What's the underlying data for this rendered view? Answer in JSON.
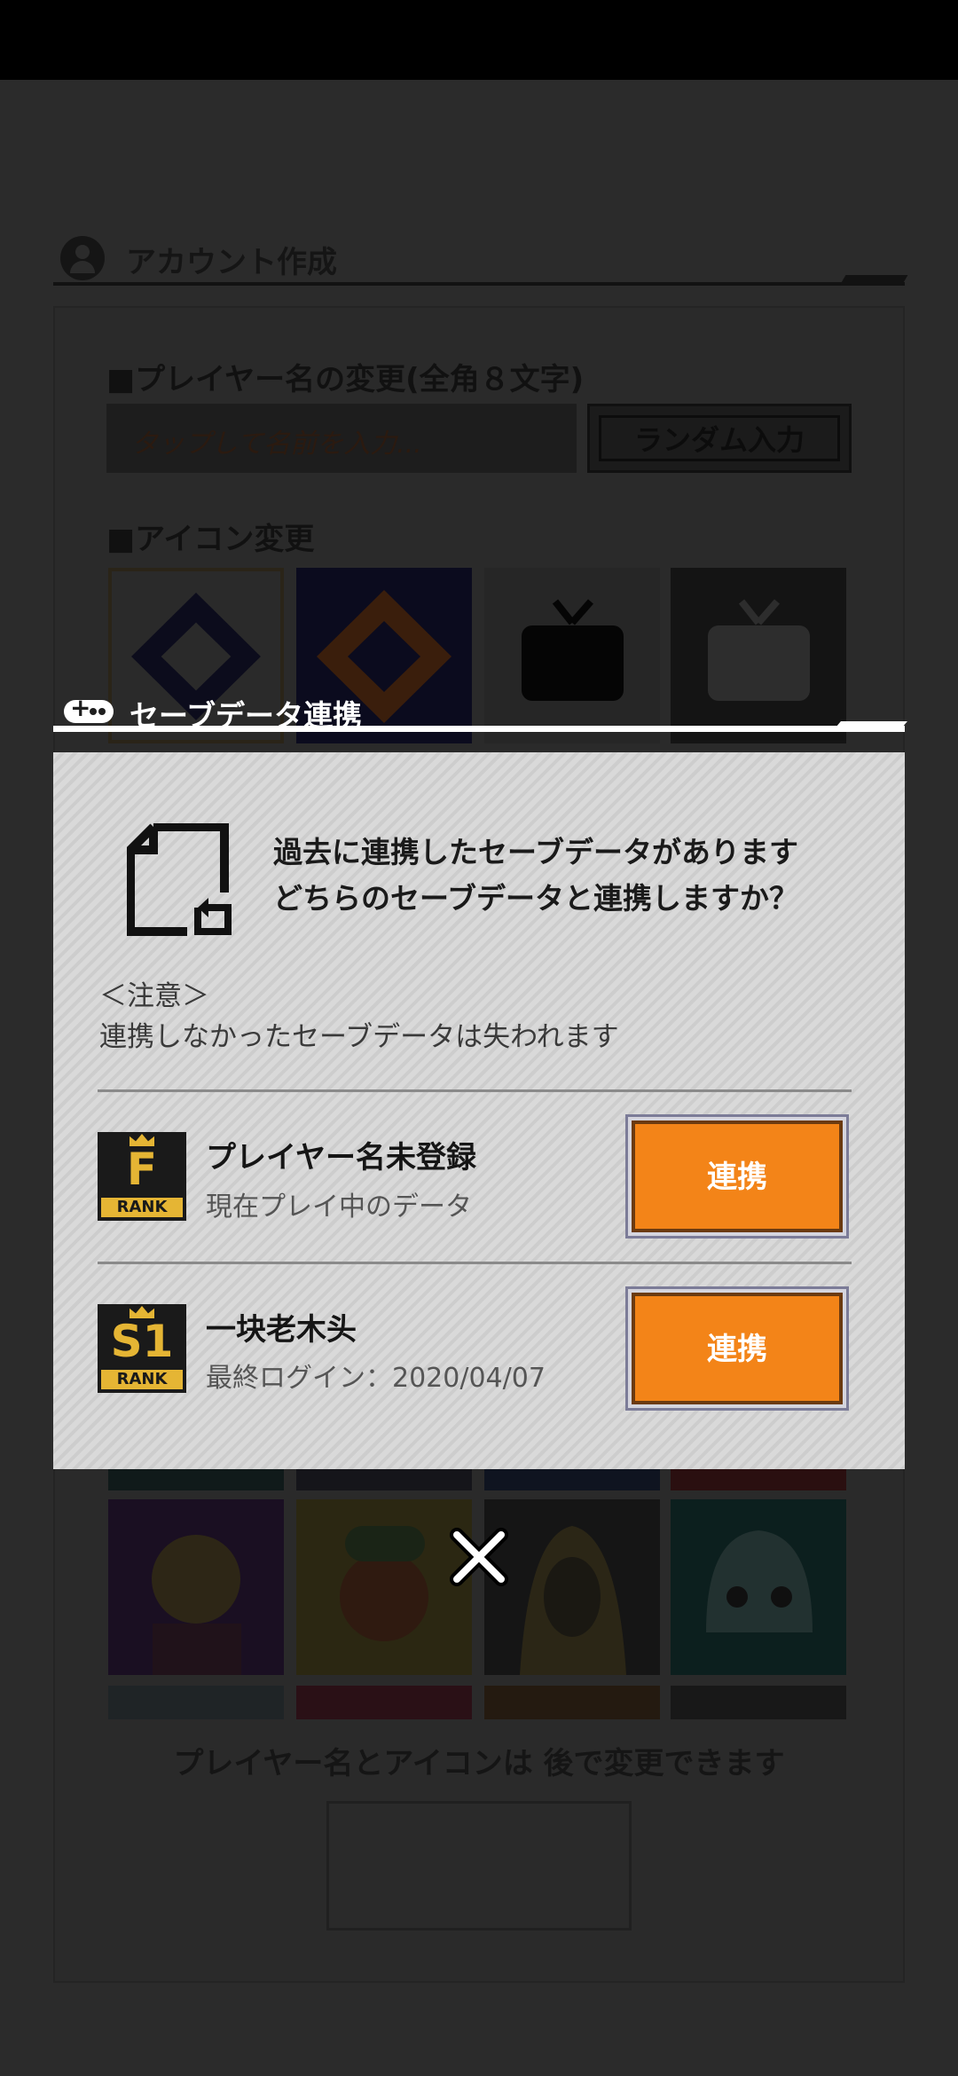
{
  "account": {
    "title": "アカウント作成",
    "name_section": "■プレイヤー名の変更(全角８文字)",
    "name_placeholder": "タップして名前を入力...",
    "random_button": "ランダム入力",
    "icon_section": "■アイコン変更",
    "bottom_note": "プレイヤー名とアイコンは 後で変更できます"
  },
  "modal": {
    "title": "セーブデータ連携",
    "message_line1": "過去に連携したセーブデータがあります",
    "message_line2": "どちらのセーブデータと連携しますか？",
    "notice_title": "＜注意＞",
    "notice_body": "連携しなかったセーブデータは失われます",
    "entries": [
      {
        "rank": "F",
        "rank_label": "RANK",
        "name": "プレイヤー名未登録",
        "sub": "現在プレイ中のデータ",
        "button": "連携"
      },
      {
        "rank": "S1",
        "rank_label": "RANK",
        "name": "一块老木头",
        "sub": "最終ログイン：2020/04/07",
        "button": "連携"
      }
    ]
  },
  "colors": {
    "accent_orange": "#f38418",
    "rank_gold": "#e5b534"
  }
}
